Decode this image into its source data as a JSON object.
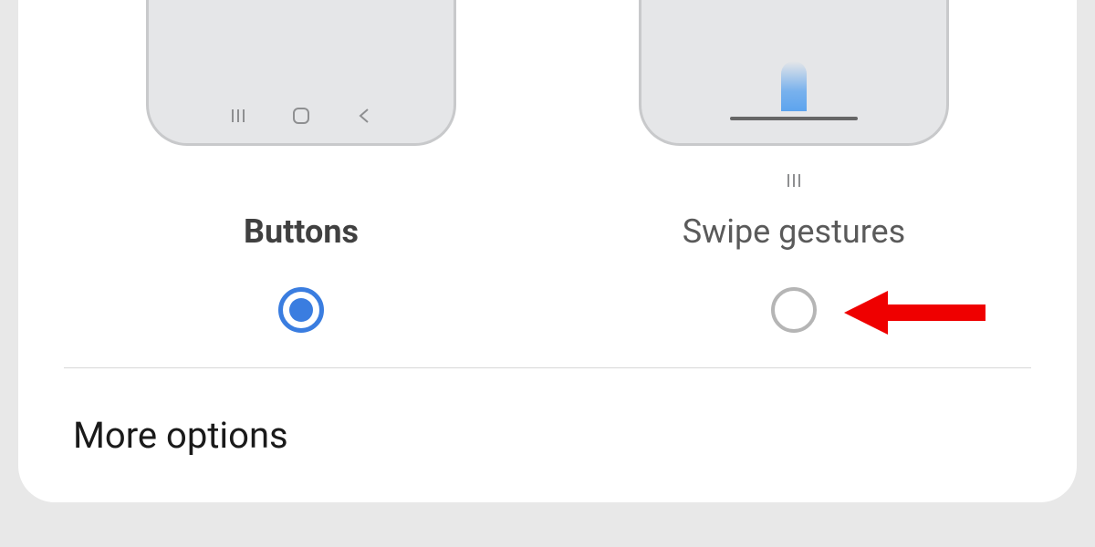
{
  "navigation_type": {
    "options": [
      {
        "label": "Buttons",
        "selected": true
      },
      {
        "label": "Swipe gestures",
        "selected": false
      }
    ]
  },
  "more_options": {
    "label": "More options"
  },
  "colors": {
    "accent": "#3a7de0",
    "arrow": "#ef0000",
    "preview_bg": "#e5e6e8"
  }
}
